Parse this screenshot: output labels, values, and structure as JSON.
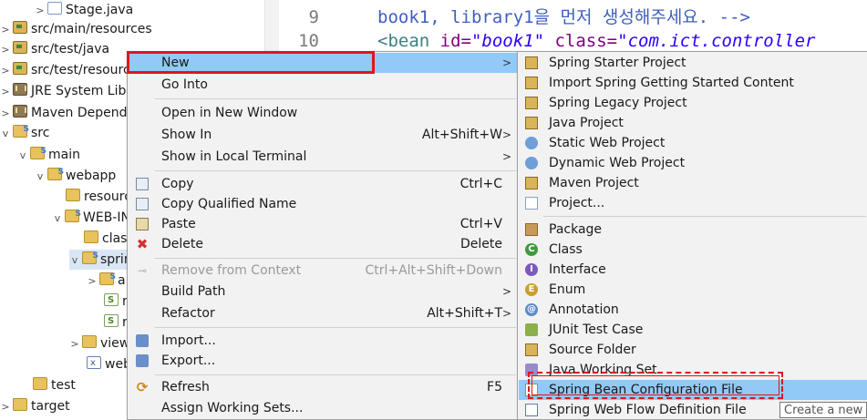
{
  "tree": {
    "rows": [
      {
        "label": "Stage.java"
      },
      {
        "label": "src/main/resources"
      },
      {
        "label": "src/test/java"
      },
      {
        "label": "src/test/resources"
      },
      {
        "label": "JRE System Library"
      },
      {
        "label": "Maven Dependencies"
      },
      {
        "label": "src"
      },
      {
        "label": "main"
      },
      {
        "label": "webapp"
      },
      {
        "label": "resources"
      },
      {
        "label": "WEB-INF"
      },
      {
        "label": "classes"
      },
      {
        "label": "spring"
      },
      {
        "label": "a"
      },
      {
        "label": "r"
      },
      {
        "label": "r"
      },
      {
        "label": "views"
      },
      {
        "label": "web.xml"
      },
      {
        "label": "test"
      },
      {
        "label": "target"
      }
    ]
  },
  "editor": {
    "line9_num": "9",
    "line9_text": "book1, library1을 먼저 생성해주세요. -->",
    "line10_num": "10",
    "line10_tag": "<bean ",
    "line10_attr1": "id=",
    "line10_val1": "\"book1\"",
    "line10_attr2": " class=",
    "line10_val2": "\"com.ict.controller"
  },
  "context_menu": {
    "new": "New",
    "go_into": "Go Into",
    "open_new_window": "Open in New Window",
    "show_in": "Show In",
    "show_in_shortcut": "Alt+Shift+W",
    "show_local_terminal": "Show in Local Terminal",
    "copy": "Copy",
    "copy_shortcut": "Ctrl+C",
    "copy_qualified": "Copy Qualified Name",
    "paste": "Paste",
    "paste_shortcut": "Ctrl+V",
    "delete": "Delete",
    "delete_shortcut": "Delete",
    "remove_context": "Remove from Context",
    "remove_context_shortcut": "Ctrl+Alt+Shift+Down",
    "build_path": "Build Path",
    "refactor": "Refactor",
    "refactor_shortcut": "Alt+Shift+T",
    "import": "Import...",
    "export": "Export...",
    "refresh": "Refresh",
    "refresh_shortcut": "F5",
    "assign_working_sets": "Assign Working Sets..."
  },
  "submenu": {
    "items": [
      {
        "label": "Spring Starter Project"
      },
      {
        "label": "Import Spring Getting Started Content"
      },
      {
        "label": "Spring Legacy Project"
      },
      {
        "label": "Java Project"
      },
      {
        "label": "Static Web Project"
      },
      {
        "label": "Dynamic Web Project"
      },
      {
        "label": "Maven Project"
      },
      {
        "label": "Project..."
      },
      {
        "label": "Package"
      },
      {
        "label": "Class"
      },
      {
        "label": "Interface"
      },
      {
        "label": "Enum"
      },
      {
        "label": "Annotation"
      },
      {
        "label": "JUnit Test Case"
      },
      {
        "label": "Source Folder"
      },
      {
        "label": "Java Working Set"
      },
      {
        "label": "Spring Bean Configuration File"
      },
      {
        "label": "Spring Web Flow Definition File"
      }
    ]
  },
  "tooltip": {
    "text": "Create a new"
  },
  "colors": {
    "highlight": "#91c9f7",
    "annotation_red": "#e0141e",
    "menu_bg": "#f2f2f2"
  }
}
